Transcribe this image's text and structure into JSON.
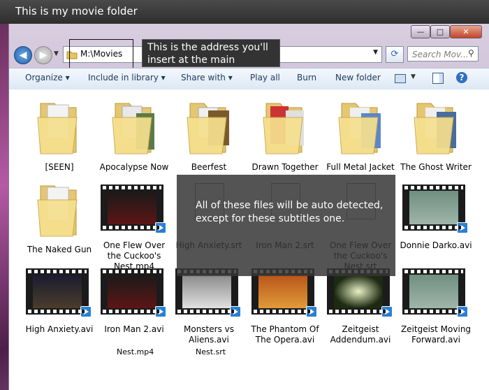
{
  "topbar": {
    "title": "This is my movie folder"
  },
  "window_controls": {
    "minimize": "—",
    "maximize": "□",
    "close": "✕"
  },
  "nav": {
    "back_icon": "arrow-left-icon",
    "forward_icon": "arrow-right-icon"
  },
  "address": {
    "value": "M:\\Movies",
    "refresh_icon": "refresh-icon"
  },
  "search": {
    "placeholder": "Search Mov..."
  },
  "callout": {
    "text": "This is the address you'll insert at the main database"
  },
  "toolbar": {
    "organize": "Organize ▾",
    "include": "Include in library ▾",
    "share": "Share with ▾",
    "play": "Play all",
    "burn": "Burn",
    "new_folder": "New folder",
    "views_icon": "views-icon",
    "preview_icon": "preview-pane-icon",
    "help_icon": "help-icon"
  },
  "row1": [
    {
      "label": "[SEEN]"
    },
    {
      "label": "Apocalypse Now"
    },
    {
      "label": "Beerfest"
    },
    {
      "label": "Drawn Together"
    },
    {
      "label": "Full Metal Jacket"
    },
    {
      "label": "The Ghost Writer"
    }
  ],
  "row2": [
    {
      "label": "The Naked Gun"
    },
    {
      "label": "One Flew Over the Cuckoo's Nest.mp4"
    },
    {
      "label": "High Anxiety.srt"
    },
    {
      "label": "Iron Man 2.srt"
    },
    {
      "label": "One Flew Over the Cuckoo's Nest.srt"
    },
    {
      "label": "Donnie Darko.avi"
    }
  ],
  "row3": [
    {
      "label": "High Anxiety.avi"
    },
    {
      "label": "Iron Man 2.avi"
    },
    {
      "label": "Monsters vs Aliens.avi"
    },
    {
      "label": "The Phantom Of The Opera.avi"
    },
    {
      "label": "Zeitgeist Addendum.avi"
    },
    {
      "label": "Zeitgeist Moving Forward.avi"
    }
  ],
  "extra": {
    "nest_mp4": "Nest.mp4",
    "nest_srt": "Nest.srt"
  },
  "overlay": {
    "text": "All of these files will be auto detected, except for these subtitles one."
  }
}
